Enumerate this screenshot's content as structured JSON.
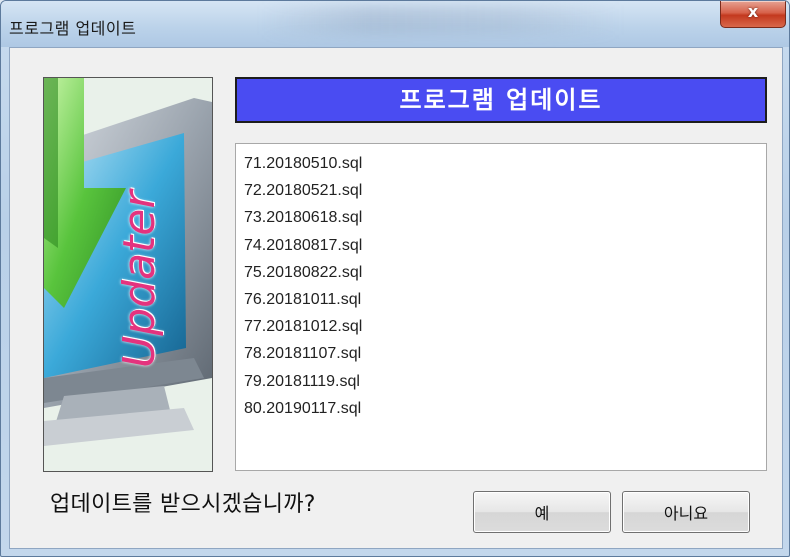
{
  "window": {
    "title": "프로그램 업데이트",
    "close_symbol": "x"
  },
  "side_image": {
    "caption": "Updater",
    "icon": "download-monitor-icon"
  },
  "header": {
    "title": "프로그램 업데이트",
    "background_color": "#4a4cf2"
  },
  "file_list": {
    "items": [
      "71.20180510.sql",
      "72.20180521.sql",
      "73.20180618.sql",
      "74.20180817.sql",
      "75.20180822.sql",
      "76.20181011.sql",
      "77.20181012.sql",
      "78.20181107.sql",
      "79.20181119.sql",
      "80.20190117.sql"
    ]
  },
  "prompt": {
    "text": "업데이트를 받으시겠습니까?"
  },
  "buttons": {
    "yes_label": "예",
    "no_label": "아니요"
  }
}
